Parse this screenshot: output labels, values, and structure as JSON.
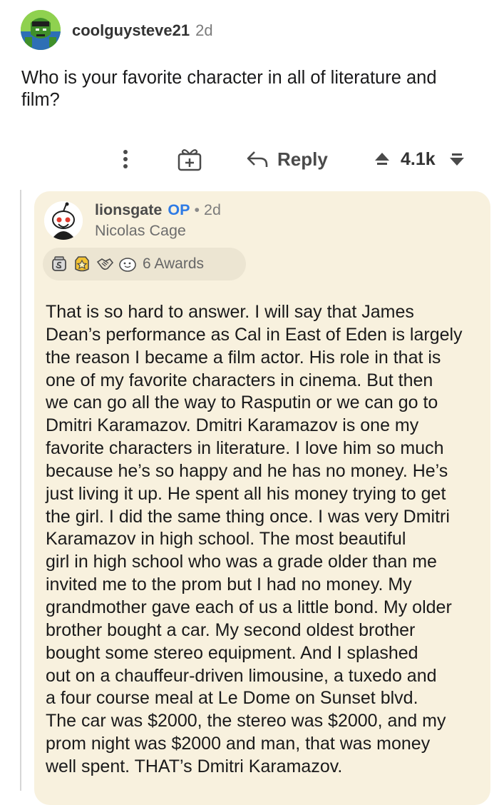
{
  "post": {
    "username": "coolguysteve21",
    "time": "2d",
    "question": "Who is your favorite character in all of literature and film?"
  },
  "actions": {
    "reply_label": "Reply",
    "vote_count": "4.1k"
  },
  "reply": {
    "username": "lionsgate",
    "op_badge": "OP",
    "separator": "•",
    "time": "2d",
    "flair": "Nicolas Cage",
    "awards_label": "6 Awards",
    "award_icons": [
      "silver-award-icon",
      "gold-award-icon",
      "handshake-award-icon",
      "wholesome-award-icon"
    ],
    "body_lines": [
      "That is so hard to answer. I will say that James",
      "Dean’s performance as Cal in East of Eden is largely",
      "the reason I became a film actor. His role in that is",
      "one of my favorite characters in cinema. But then",
      "we can go all the way to Rasputin or we can go to",
      "Dmitri Karamazov. Dmitri Karamazov is one my",
      "favorite characters in literature. I love him so much",
      "because he’s so happy and he has no money. He’s",
      "just living it up. He spent all his money trying to get",
      "the girl. I did the same thing once. I was very Dmitri",
      "Karamazov in high school. The most beautiful",
      "girl in high school who was a grade older than me",
      "invited me to the prom but I had no money. My",
      "grandmother gave each of us a little bond. My older",
      "brother bought a car. My second oldest brother",
      "bought some stereo equipment. And I splashed",
      "out on a chauffeur-driven limousine, a tuxedo and",
      "a four course meal at Le Dome on Sunset blvd.",
      "The car was $2000, the stereo was $2000, and my",
      "prom night was $2000 and man, that was money",
      "well spent. THAT’s Dmitri Karamazov."
    ]
  },
  "colors": {
    "op_blue": "#2f7be5",
    "card_bg": "#f8f1de",
    "awards_bg": "#ece5d2"
  }
}
